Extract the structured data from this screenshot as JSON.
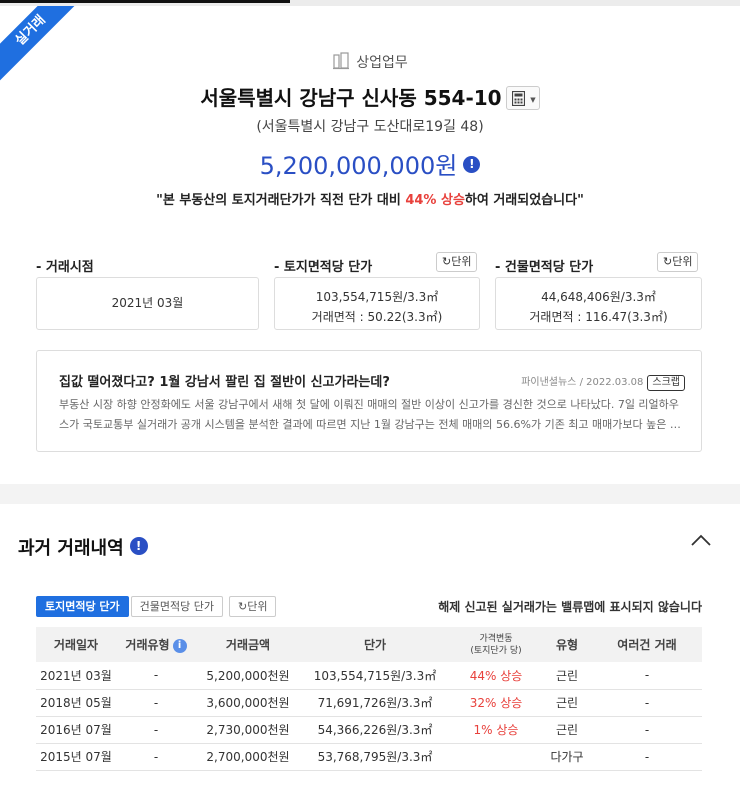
{
  "badge": "실거래",
  "category": "상업업무",
  "address": "서울특별시 강남구 신사동 554-10",
  "road_address": "(서울특별시 강남구 도산대로19길 48)",
  "price": "5,200,000,000원",
  "summary": {
    "prefix": "\"본 부동산의 토지거래단가가 직전 단가 대비 ",
    "highlight": "44% 상승",
    "suffix": "하여 거래되었습니다\""
  },
  "labels": {
    "trade_time": "- 거래시점",
    "land_price": "- 토지면적당 단가",
    "building_price": "- 건물면적당 단가",
    "unit_btn": "단위"
  },
  "values": {
    "trade_time": "2021년 03월",
    "land_unit_price": "103,554,715원/3.3㎡",
    "land_area": "거래면적 : 50.22(3.3㎡)",
    "building_unit_price": "44,648,406원/3.3㎡",
    "building_area": "거래면적 : 116.47(3.3㎡)"
  },
  "news": {
    "title": "집값 떨어졌다고? 1월 강남서 팔린 집 절반이 신고가라는데?",
    "source": "파이낸셜뉴스",
    "date": "2022.03.08",
    "scrap": "스크랩",
    "body": "부동산 시장 하향 안정화에도 서울 강남구에서 새해 첫 달에 이뤄진 매매의 절반 이상이 신고가를 경신한 것으로 나타났다. 7일 리얼하우스가 국토교통부 실거래가 공개 시스템을 분석한 결과에 따르면 지난 1월 강남구는 전체 매매의 56.6%가 기존 최고 매매가보다 높은 …"
  },
  "history": {
    "title": "과거 거래내역",
    "tabs": [
      "토지면적당 단가",
      "건물면적당 단가"
    ],
    "unit_btn": "단위",
    "note": "해제 신고된 실거래가는 밸류맵에 표시되지 않습니다",
    "columns": [
      "거래일자",
      "거래유형",
      "거래금액",
      "단가",
      "가격변동",
      "(토지단가 당)",
      "유형",
      "여러건 거래"
    ],
    "rows": [
      {
        "date": "2021년 03월",
        "type": "-",
        "amount": "5,200,000천원",
        "unit": "103,554,715원/3.3㎡",
        "change": "44% 상승",
        "kind": "근린",
        "multi": "-"
      },
      {
        "date": "2018년 05월",
        "type": "-",
        "amount": "3,600,000천원",
        "unit": "71,691,726원/3.3㎡",
        "change": "32% 상승",
        "kind": "근린",
        "multi": "-"
      },
      {
        "date": "2016년 07월",
        "type": "-",
        "amount": "2,730,000천원",
        "unit": "54,366,226원/3.3㎡",
        "change": "1% 상승",
        "kind": "근린",
        "multi": "-"
      },
      {
        "date": "2015년 07월",
        "type": "-",
        "amount": "2,700,000천원",
        "unit": "53,768,795원/3.3㎡",
        "change": "",
        "kind": "다가구",
        "multi": "-"
      }
    ]
  },
  "colors": {
    "accent": "#1f6fe0",
    "price": "#2a4fc4",
    "rise": "#e8413c"
  }
}
